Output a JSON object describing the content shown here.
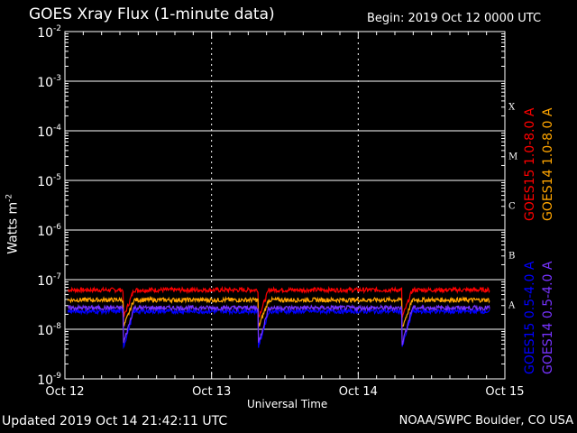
{
  "title": "GOES Xray Flux (1-minute data)",
  "begin": "Begin:  2019 Oct 12 0000 UTC",
  "updated": "Updated 2019 Oct 14 21:42:11 UTC",
  "credit": "NOAA/SWPC Boulder, CO USA",
  "chart_data": {
    "type": "line",
    "title": "GOES Xray Flux (1-minute data)",
    "xlabel": "Universal Time",
    "ylabel": "Watts m",
    "ylabel_sup": "-2",
    "yscale": "log",
    "ylim": [
      1e-09,
      0.01
    ],
    "xlim": [
      0,
      3
    ],
    "x_ticks": [
      {
        "x": 0,
        "label": "Oct 12"
      },
      {
        "x": 1,
        "label": "Oct 13"
      },
      {
        "x": 2,
        "label": "Oct 14"
      },
      {
        "x": 3,
        "label": "Oct 15"
      }
    ],
    "y_ticks": [
      {
        "exp": -2,
        "base": "10",
        "sup": "-2"
      },
      {
        "exp": -3,
        "base": "10",
        "sup": "-3"
      },
      {
        "exp": -4,
        "base": "10",
        "sup": "-4"
      },
      {
        "exp": -5,
        "base": "10",
        "sup": "-5"
      },
      {
        "exp": -6,
        "base": "10",
        "sup": "-6"
      },
      {
        "exp": -7,
        "base": "10",
        "sup": "-7"
      },
      {
        "exp": -8,
        "base": "10",
        "sup": "-8"
      },
      {
        "exp": -9,
        "base": "10",
        "sup": "-9"
      }
    ],
    "flare_classes": [
      {
        "label": "X",
        "exp": -3.5
      },
      {
        "label": "M",
        "exp": -4.5
      },
      {
        "label": "C",
        "exp": -5.5
      },
      {
        "label": "B",
        "exp": -6.5
      },
      {
        "label": "A",
        "exp": -7.5
      }
    ],
    "grid": true,
    "legend_placement": "right",
    "series": [
      {
        "name": "GOES15 1.0-8.0 A",
        "color": "#ff0000",
        "level": 6.2e-08,
        "data_end": 2.9
      },
      {
        "name": "GOES14 1.0-8.0 A",
        "color": "#ffa500",
        "level": 3.9e-08,
        "data_end": 2.9
      },
      {
        "name": "GOES15 0.5-4.0 A",
        "color": "#0000ff",
        "level": 2.3e-08,
        "data_end": 2.9
      },
      {
        "name": "GOES14 0.5-4.0 A",
        "color": "#7733ff",
        "level": 2.7e-08,
        "data_end": 2.9
      }
    ],
    "dips": [
      0.4,
      1.32,
      2.3
    ]
  }
}
